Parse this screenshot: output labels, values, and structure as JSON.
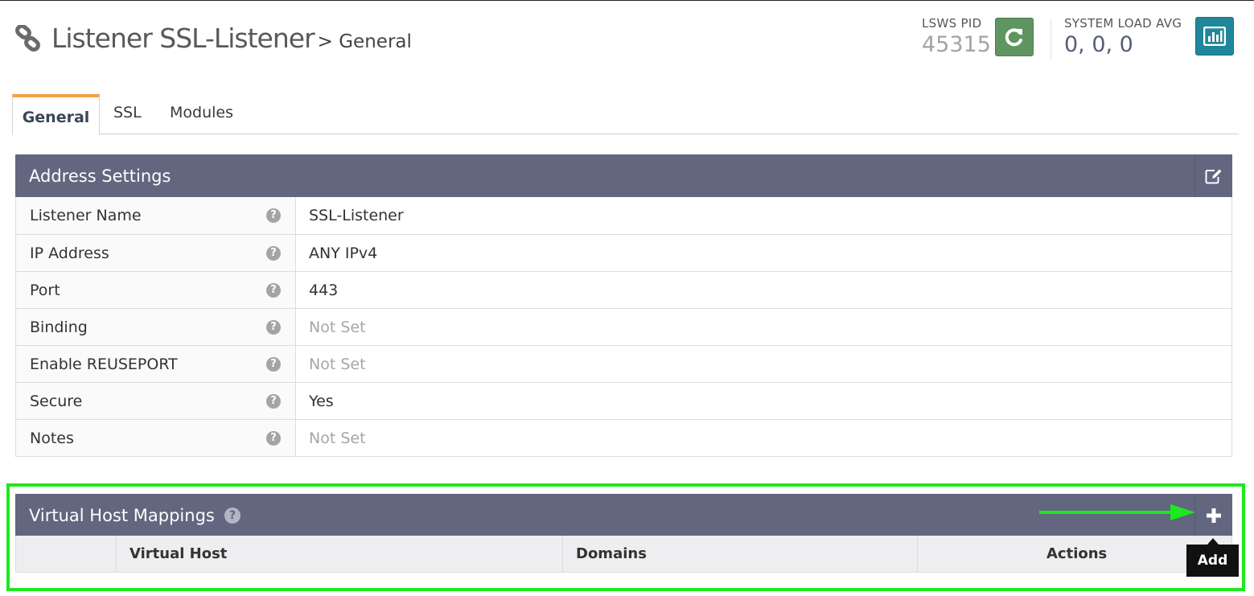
{
  "header": {
    "title": "Listener SSL-Listener",
    "subtitle": "> General"
  },
  "stats": {
    "pid_label": "LSWS PID",
    "pid_value": "45315",
    "load_label": "SYSTEM LOAD AVG",
    "load_value": "0, 0, 0"
  },
  "tabs": [
    {
      "label": "General",
      "active": true
    },
    {
      "label": "SSL",
      "active": false
    },
    {
      "label": "Modules",
      "active": false
    }
  ],
  "address_settings": {
    "title": "Address Settings",
    "rows": [
      {
        "label": "Listener Name",
        "value": "SSL-Listener",
        "muted": false
      },
      {
        "label": "IP Address",
        "value": "ANY IPv4",
        "muted": false
      },
      {
        "label": "Port",
        "value": "443",
        "muted": false
      },
      {
        "label": "Binding",
        "value": "Not Set",
        "muted": true
      },
      {
        "label": "Enable REUSEPORT",
        "value": "Not Set",
        "muted": true
      },
      {
        "label": "Secure",
        "value": "Yes",
        "muted": false
      },
      {
        "label": "Notes",
        "value": "Not Set",
        "muted": true
      }
    ]
  },
  "vh_mappings": {
    "title": "Virtual Host Mappings",
    "columns": [
      "Virtual Host",
      "Domains",
      "Actions"
    ],
    "tooltip": "Add"
  },
  "colors": {
    "panel_header": "#62667f",
    "tab_accent": "#f0a14a",
    "highlight": "#1ee81e",
    "restart_button": "#5e9561",
    "chart_button": "#1f8799"
  },
  "icons": {
    "header": "link-icon",
    "restart": "refresh-icon",
    "chart": "bar-chart-icon",
    "edit": "edit-icon",
    "add": "plus-icon",
    "help": "question-circle-icon"
  }
}
